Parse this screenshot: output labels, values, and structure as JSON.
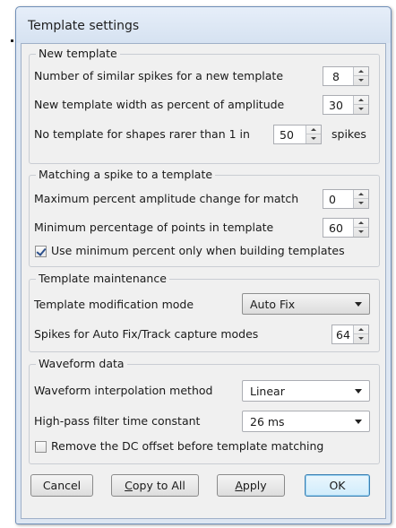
{
  "dialog": {
    "title": "Template settings"
  },
  "new_template": {
    "legend": "New template",
    "similar_spikes_label": "Number of similar spikes for a new template",
    "similar_spikes_value": "8",
    "width_percent_label": "New template width as percent of amplitude",
    "width_percent_value": "30",
    "rarer_label_prefix": "No template for shapes rarer than 1 in",
    "rarer_value": "50",
    "rarer_label_suffix": "spikes"
  },
  "matching": {
    "legend": "Matching a spike to a template",
    "max_amp_change_label": "Maximum percent amplitude change for match",
    "max_amp_change_value": "0",
    "min_points_label": "Minimum percentage of points in template",
    "min_points_value": "60",
    "use_min_only_label": "Use minimum percent only when building templates",
    "use_min_only_checked": true
  },
  "maintenance": {
    "legend": "Template maintenance",
    "mode_label": "Template modification mode",
    "mode_value": "Auto Fix",
    "capture_label": "Spikes for Auto Fix/Track capture modes",
    "capture_value": "64"
  },
  "waveform": {
    "legend": "Waveform data",
    "interp_label": "Waveform interpolation method",
    "interp_value": "Linear",
    "highpass_label": "High-pass filter time constant",
    "highpass_value": "26 ms",
    "remove_dc_label": "Remove the DC offset before template matching",
    "remove_dc_checked": false
  },
  "buttons": {
    "cancel": "Cancel",
    "copy_to_all_mnemonic": "C",
    "copy_to_all_rest": "opy to All",
    "apply_mnemonic": "A",
    "apply_rest": "pply",
    "ok": "OK"
  }
}
